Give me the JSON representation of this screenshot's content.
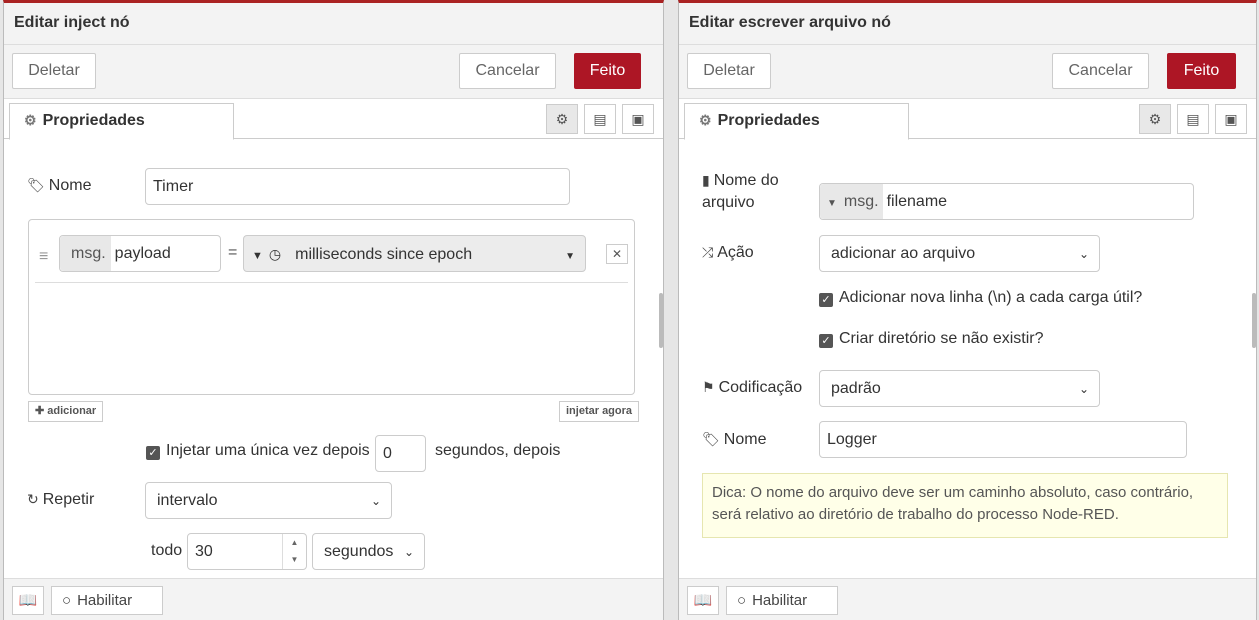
{
  "left": {
    "title": "Editar inject nó",
    "delete_label": "Deletar",
    "cancel_label": "Cancelar",
    "done_label": "Feito",
    "tab_label": "Propriedades",
    "name_label": "Nome",
    "name_value": "Timer",
    "prop": {
      "prefix": "msg.",
      "key": "payload",
      "equals": "=",
      "value": "milliseconds since epoch"
    },
    "add_label": "adicionar",
    "inject_now_label": "injetar agora",
    "once_label": "Injetar uma única vez depois",
    "once_value": "0",
    "once_suffix": "segundos, depois",
    "repeat_label": "Repetir",
    "repeat_value": "intervalo",
    "every_label": "todo",
    "every_value": "30",
    "unit_value": "segundos",
    "enable_label": "Habilitar"
  },
  "right": {
    "title": "Editar escrever arquivo nó",
    "delete_label": "Deletar",
    "cancel_label": "Cancelar",
    "done_label": "Feito",
    "tab_label": "Propriedades",
    "filename_label_1": "Nome do",
    "filename_label_2": "arquivo",
    "filename_prefix": "msg.",
    "filename_value": "filename",
    "action_label": "Ação",
    "action_value": "adicionar ao arquivo",
    "newline_label": "Adicionar nova linha (\\n) a cada carga útil?",
    "createdir_label": "Criar diretório se não existir?",
    "encoding_label": "Codificação",
    "encoding_value": "padrão",
    "name_label": "Nome",
    "name_value": "Logger",
    "tip": "Dica: O nome do arquivo deve ser um caminho absoluto, caso contrário, será relativo ao diretório de trabalho do processo Node-RED.",
    "enable_label": "Habilitar"
  },
  "colors": {
    "accent": "#ad1625",
    "header_bg": "#f3f3f3",
    "tip_bg": "#ffffe8"
  },
  "icons": [
    "gear-icon",
    "document-icon",
    "frame-icon",
    "tag-icon",
    "drag-handle-icon",
    "clock-icon",
    "remove-icon",
    "plus-icon",
    "refresh-icon",
    "file-icon",
    "shuffle-icon",
    "flag-icon",
    "book-icon",
    "circle-icon",
    "caret-down-icon",
    "chevron-down-icon"
  ]
}
